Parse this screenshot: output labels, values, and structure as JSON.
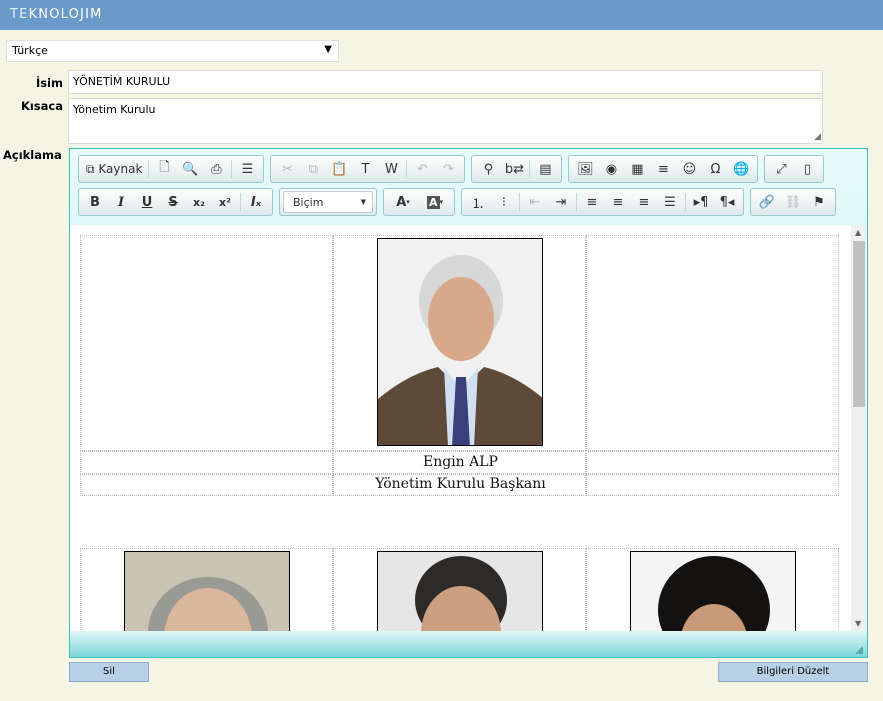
{
  "app": {
    "logo_first": "TE",
    "logo_rest": "KNOLOJIM"
  },
  "language": {
    "selected": "Türkçe"
  },
  "form": {
    "isim_label": "İsim",
    "isim_value": "YÖNETİM KURULU",
    "kisaca_label": "Kısaca",
    "kisaca_value": "Yönetim Kurulu",
    "aciklama_label": "Açıklama"
  },
  "editor": {
    "source_label": "Kaynak",
    "format_combo": "Biçim",
    "toolbar_row1": [
      "source",
      "new-page",
      "preview",
      "print",
      "templates",
      "cut",
      "copy",
      "paste",
      "paste-text",
      "paste-word",
      "undo",
      "redo",
      "find",
      "replace",
      "select-all",
      "image",
      "flash",
      "table",
      "horizontal-rule",
      "smiley",
      "special-char",
      "iframe",
      "maximize",
      "show-blocks"
    ],
    "toolbar_row2": [
      "bold",
      "italic",
      "underline",
      "strike",
      "subscript",
      "superscript",
      "remove-format",
      "format",
      "text-color",
      "bg-color",
      "numbered-list",
      "bulleted-list",
      "outdent",
      "indent",
      "align-left",
      "align-center",
      "align-right",
      "justify",
      "ltr",
      "rtl",
      "link",
      "unlink",
      "anchor"
    ]
  },
  "content": {
    "chairman": {
      "name": "Engin ALP",
      "title": "Yönetim Kurulu Başkanı"
    }
  },
  "buttons": {
    "delete": "Sil",
    "save": "Bilgileri Düzelt"
  },
  "colors": {
    "topbar": "#6a9ac9",
    "editor_border": "#3cc0c6",
    "button": "#b8cfe8"
  }
}
